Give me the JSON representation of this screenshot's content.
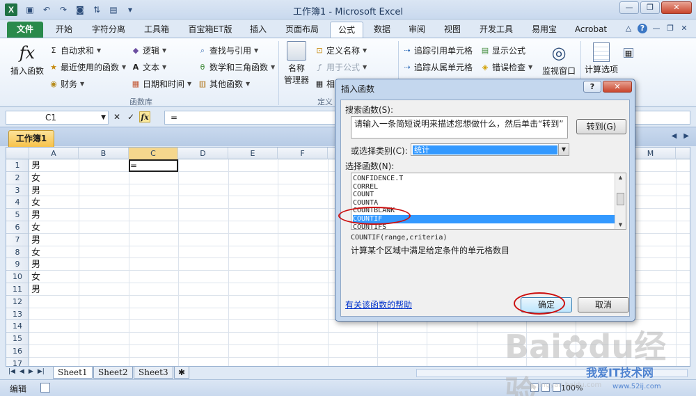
{
  "app": {
    "title": "工作簿1 - Microsoft Excel",
    "logo_text": "X"
  },
  "ribbon_tabs": [
    {
      "label": "文件",
      "kind": "file"
    },
    {
      "label": "开始"
    },
    {
      "label": "字符分离"
    },
    {
      "label": "工具箱"
    },
    {
      "label": "百宝箱ET版"
    },
    {
      "label": "插入"
    },
    {
      "label": "页面布局"
    },
    {
      "label": "公式",
      "active": true
    },
    {
      "label": "数据"
    },
    {
      "label": "审阅"
    },
    {
      "label": "视图"
    },
    {
      "label": "开发工具"
    },
    {
      "label": "易用宝"
    },
    {
      "label": "Acrobat"
    }
  ],
  "ribbon": {
    "insert_function": "插入函数",
    "fx_glyph": "fx",
    "autosum": "自动求和",
    "recent": "最近使用的函数",
    "financial": "财务",
    "logical": "逻辑",
    "text": "文本",
    "datetime": "日期和时间",
    "lookup": "查找与引用",
    "math": "数学和三角函数",
    "more": "其他函数",
    "library_group": "函数库",
    "name_manager_line1": "名称",
    "name_manager_line2": "管理器",
    "define_name": "定义名称",
    "use_in_formula": "用于公式",
    "defined_group_partial": "定义",
    "trace_precedents": "追踪引用单元格",
    "trace_dependents": "追踪从属单元格",
    "show_formulas": "显示公式",
    "error_checking": "错误检查",
    "watch_window": "监视窗口",
    "calc_options": "计算选项",
    "partial_char": "相"
  },
  "formula_bar": {
    "name_box": "C1",
    "fx_label": "fx",
    "formula": "="
  },
  "workbook_tab": "工作簿1",
  "columns": [
    "A",
    "B",
    "C",
    "D",
    "E",
    "F",
    "M"
  ],
  "rows": [
    "1",
    "2",
    "3",
    "4",
    "5",
    "6",
    "7",
    "8",
    "9",
    "10",
    "11",
    "12",
    "13",
    "14",
    "15",
    "16",
    "17"
  ],
  "col_a_values": [
    "男",
    "女",
    "男",
    "女",
    "男",
    "女",
    "男",
    "女",
    "男",
    "女",
    "男"
  ],
  "cell_c1": "=",
  "sheets": [
    "Sheet1",
    "Sheet2",
    "Sheet3"
  ],
  "status": {
    "mode": "编辑",
    "zoom": "100%"
  },
  "dialog": {
    "title": "插入函数",
    "help_btn": "?",
    "close_btn": "✕",
    "search_label": "搜索函数(S):",
    "search_value": "请输入一条简短说明来描述您想做什么，然后单击“转到”",
    "go_button": "转到(G)",
    "category_label": "或选择类别(C):",
    "category_value": "统计",
    "select_label": "选择函数(N):",
    "functions": [
      "CONFIDENCE.T",
      "CORREL",
      "COUNT",
      "COUNTA",
      "COUNTBLANK",
      "COUNTIF",
      "COUNTIFS"
    ],
    "selected_function": "COUNTIF",
    "syntax": "COUNTIF(range,criteria)",
    "description": "计算某个区域中满足给定条件的单元格数目",
    "help_link": "有关该函数的帮助",
    "ok": "确定",
    "cancel": "取消"
  },
  "watermark": {
    "baidu": "Bai",
    "jingyan": "经验",
    "site": "jingyan.baidu.com",
    "brand": "我爱IT技术网",
    "brand_url": "www.52ij.com"
  },
  "colors": {
    "file_tab": "#2a8a4b",
    "selection": "#3399ff",
    "annotation": "#cc1010",
    "workbook_tab": "#f7c24a"
  }
}
